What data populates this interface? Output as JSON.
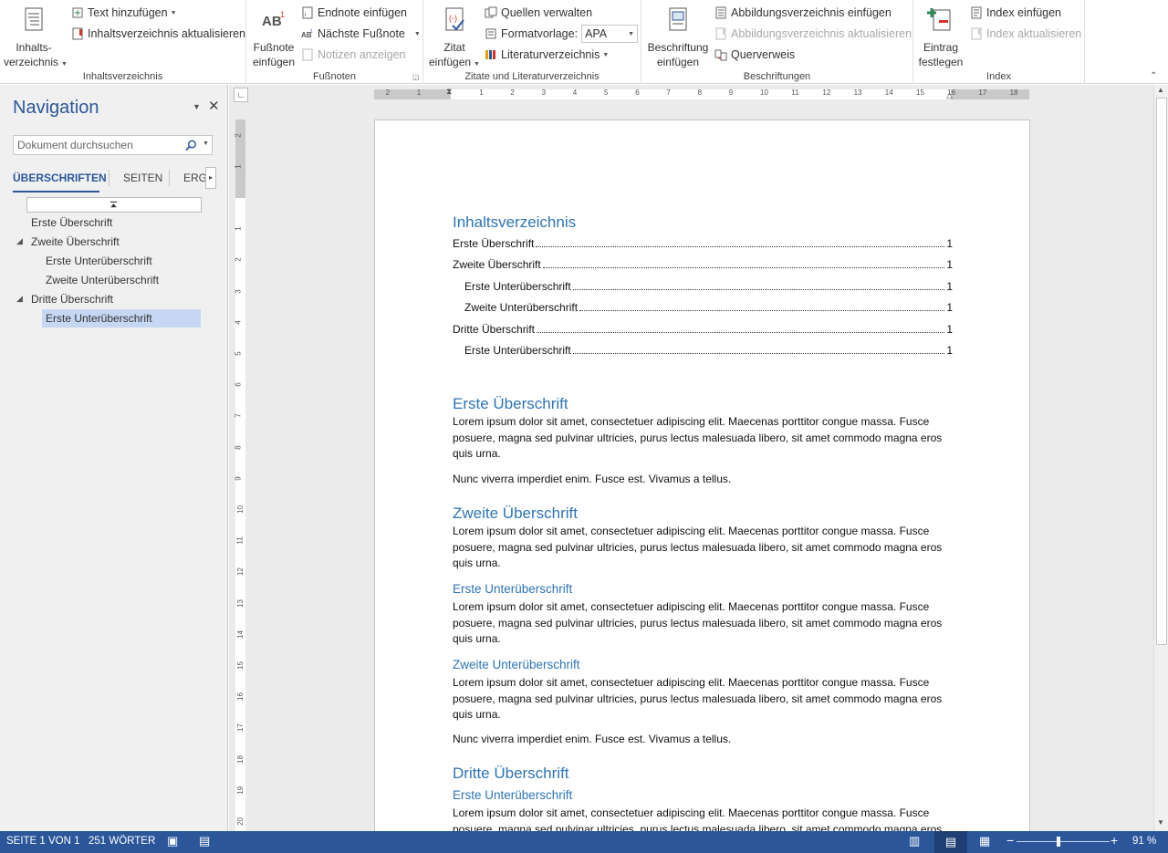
{
  "ribbon": {
    "toc_group": {
      "label": "Inhaltsverzeichnis",
      "big_btn": [
        "Inhalts-",
        "verzeichnis"
      ],
      "add_text": "Text hinzufügen",
      "update_toc": "Inhaltsverzeichnis aktualisieren"
    },
    "footnotes_group": {
      "label": "Fußnoten",
      "big_btn": [
        "Fußnote",
        "einfügen"
      ],
      "endnote": "Endnote einfügen",
      "next_footnote": "Nächste Fußnote",
      "show_notes": "Notizen anzeigen"
    },
    "citations_group": {
      "label": "Zitate und Literaturverzeichnis",
      "big_btn": [
        "Zitat",
        "einfügen"
      ],
      "manage_sources": "Quellen verwalten",
      "style_label": "Formatvorlage:",
      "style_value": "APA",
      "bibliography": "Literaturverzeichnis"
    },
    "captions_group": {
      "label": "Beschriftungen",
      "big_btn": [
        "Beschriftung",
        "einfügen"
      ],
      "insert_tof": "Abbildungsverzeichnis einfügen",
      "update_tof": "Abbildungsverzeichnis aktualisieren",
      "cross_ref": "Querverweis"
    },
    "index_group": {
      "label": "Index",
      "big_btn": [
        "Eintrag",
        "festlegen"
      ],
      "insert_index": "Index einfügen",
      "update_index": "Index aktualisieren"
    }
  },
  "navigation": {
    "title": "Navigation",
    "search_placeholder": "Dokument durchsuchen",
    "tabs": [
      "ÜBERSCHRIFTEN",
      "SEITEN",
      "ERGE"
    ],
    "tree": [
      {
        "label": "Erste Überschrift"
      },
      {
        "label": "Zweite Überschrift"
      },
      {
        "label": "Erste Unterüberschrift"
      },
      {
        "label": "Zweite Unterüberschrift"
      },
      {
        "label": "Dritte Überschrift"
      },
      {
        "label": "Erste Unterüberschrift"
      }
    ]
  },
  "document": {
    "toc_title": "Inhaltsverzeichnis",
    "toc": [
      {
        "text": "Erste Überschrift",
        "page": "1"
      },
      {
        "text": "Zweite Überschrift",
        "page": "1"
      },
      {
        "text": "Erste Unterüberschrift",
        "page": "1"
      },
      {
        "text": "Zweite Unterüberschrift",
        "page": "1"
      },
      {
        "text": "Dritte Überschrift",
        "page": "1"
      },
      {
        "text": "Erste Unterüberschrift",
        "page": "1"
      }
    ],
    "h_erste": "Erste Überschrift",
    "h_zweite": "Zweite Überschrift",
    "h_sub1": "Erste Unterüberschrift",
    "h_sub2": "Zweite Unterüberschrift",
    "h_dritte": "Dritte Überschrift",
    "h_sub3": "Erste Unterüberschrift",
    "lorem_l1": "Lorem ipsum dolor sit amet, consectetuer adipiscing elit. Maecenas porttitor congue massa. Fusce",
    "lorem_l2": "posuere, magna sed pulvinar ultricies, purus lectus malesuada libero, sit amet commodo magna eros",
    "lorem_l3": "quis urna.",
    "nunc": "Nunc viverra imperdiet enim. Fusce est. Vivamus a tellus."
  },
  "ruler": {
    "h_ticks": [
      "2",
      "1",
      "1",
      "2",
      "3",
      "4",
      "5",
      "6",
      "7",
      "8",
      "9",
      "10",
      "11",
      "12",
      "13",
      "14",
      "15",
      "16",
      "17",
      "18"
    ],
    "v_ticks": [
      "2",
      "1",
      "1",
      "2",
      "3",
      "4",
      "5",
      "6",
      "7",
      "8",
      "9",
      "10",
      "11",
      "12",
      "13",
      "14",
      "15",
      "16",
      "17",
      "18",
      "19",
      "20"
    ]
  },
  "statusbar": {
    "page": "SEITE 1 VON 1",
    "words": "251 WÖRTER",
    "zoom": "91 %"
  }
}
